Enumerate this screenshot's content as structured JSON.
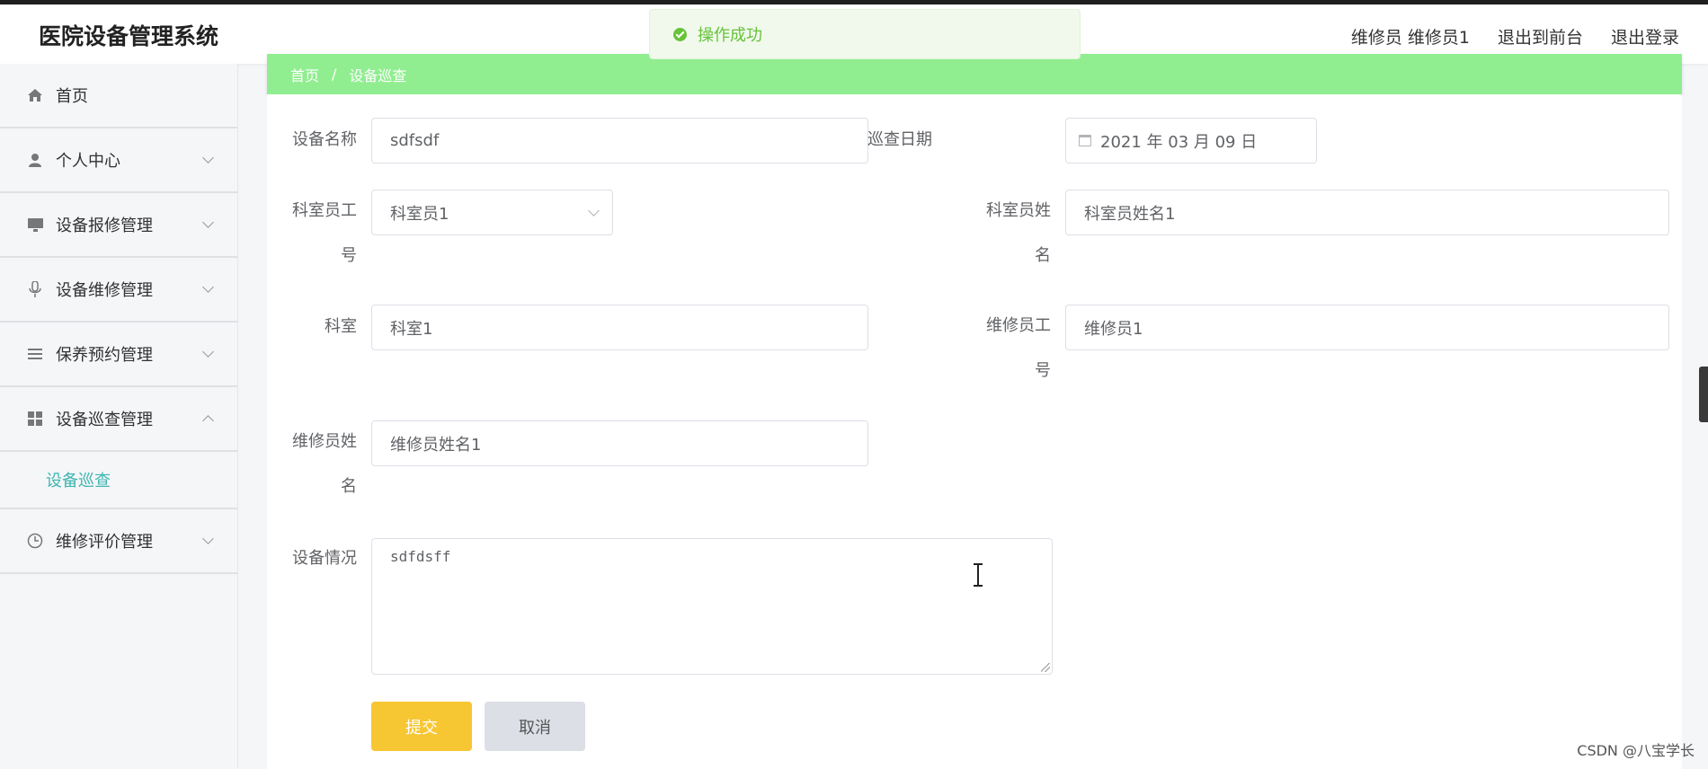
{
  "header": {
    "app_title": "医院设备管理系统",
    "user_label": "维修员 维修员1",
    "back_to_front": "退出到前台",
    "logout": "退出登录"
  },
  "toast": {
    "message": "操作成功",
    "color": "#67c23a"
  },
  "sidebar": {
    "items": [
      {
        "label": "首页",
        "icon": "home-icon"
      },
      {
        "label": "个人中心",
        "icon": "user-icon"
      },
      {
        "label": "设备报修管理",
        "icon": "monitor-icon"
      },
      {
        "label": "设备维修管理",
        "icon": "microphone-icon"
      },
      {
        "label": "保养预约管理",
        "icon": "list-icon"
      },
      {
        "label": "设备巡查管理",
        "icon": "grid-icon"
      },
      {
        "label": "维修评价管理",
        "icon": "clock-icon"
      }
    ],
    "submenu_active": "设备巡查",
    "active_color": "#3fb6b0"
  },
  "breadcrumb": {
    "home": "首页",
    "separator": "/",
    "current": "设备巡查",
    "bar_color": "#90ee90"
  },
  "form": {
    "device_name": {
      "label": "设备名称",
      "value": "sdfsdf"
    },
    "inspect_date": {
      "label": "巡查日期",
      "value": "2021 年 03 月 09 日"
    },
    "staff_id": {
      "label": "科室员工号",
      "value": "科室员1"
    },
    "staff_name": {
      "label": "科室员姓名",
      "value": "科室员姓名1"
    },
    "department": {
      "label": "科室",
      "value": "科室1"
    },
    "repairer_id": {
      "label": "维修员工号",
      "value": "维修员1"
    },
    "repairer_name": {
      "label": "维修员姓名",
      "value": "维修员姓名1"
    },
    "condition": {
      "label": "设备情况",
      "value": "sdfdsff"
    },
    "submit_label": "提交",
    "cancel_label": "取消",
    "submit_color": "#f7c633"
  },
  "watermark": "CSDN @八宝学长"
}
